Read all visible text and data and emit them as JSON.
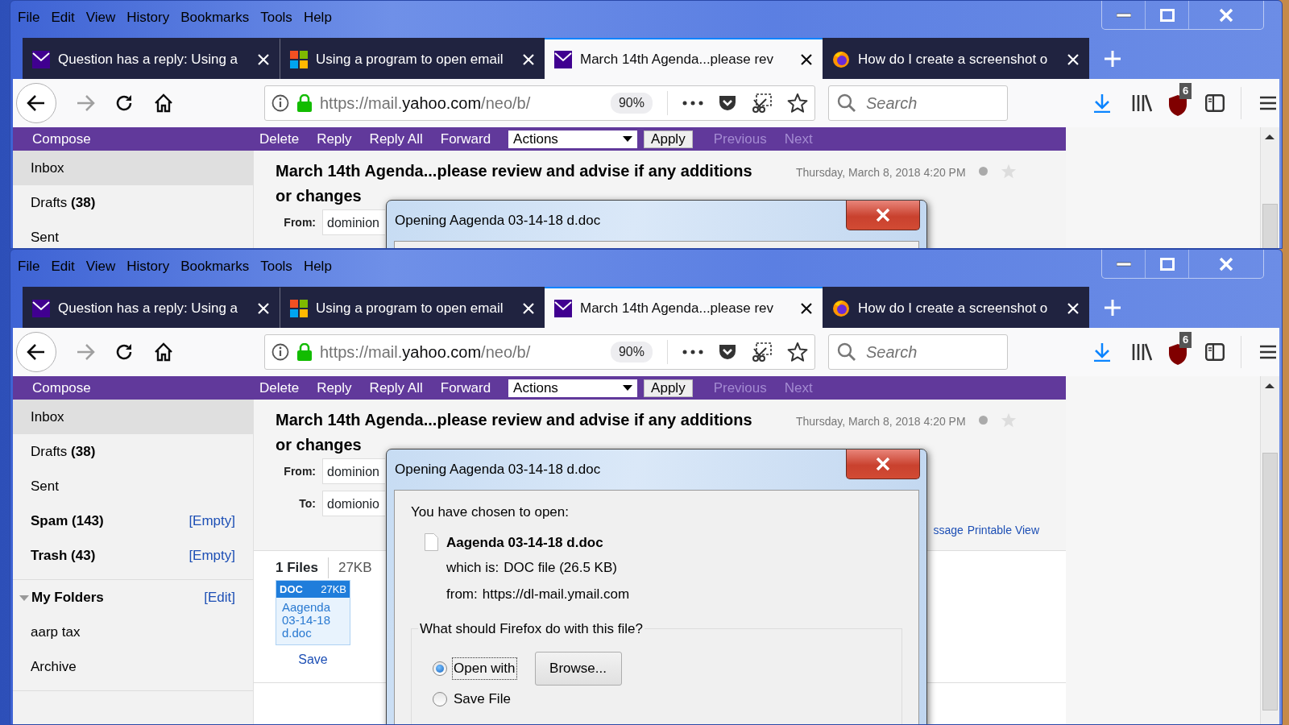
{
  "windows": [
    {
      "menu": [
        {
          "label": "File"
        },
        {
          "label": "Edit"
        },
        {
          "label": "View"
        },
        {
          "label": "History"
        },
        {
          "label": "Bookmarks"
        },
        {
          "label": "Tools"
        },
        {
          "label": "Help"
        }
      ],
      "tabs": [
        {
          "title": "Question has a reply: Using a",
          "kind": "envelope",
          "selected": false
        },
        {
          "title": "Using a program to open email",
          "kind": "squares",
          "selected": false
        },
        {
          "title": "March 14th Agenda...please rev",
          "kind": "envelope",
          "selected": true
        },
        {
          "title": "How do I create a screenshot o",
          "kind": "globe",
          "selected": false
        }
      ],
      "toolbar": {
        "url_scheme": "https://mail.",
        "url_domain": "yahoo.com",
        "url_path": "/neo/b/",
        "zoom": "90%",
        "search_placeholder": "Search",
        "addon_badge": "6"
      },
      "mail": {
        "toolbar": {
          "compose": "Compose",
          "actions": [
            {
              "label": "Delete",
              "disabled": false
            },
            {
              "label": "Reply",
              "disabled": false
            },
            {
              "label": "Reply All",
              "disabled": false
            },
            {
              "label": "Forward",
              "disabled": false
            }
          ],
          "select": "Actions",
          "apply": "Apply",
          "paging": [
            {
              "label": "Previous",
              "disabled": true
            },
            {
              "label": "Next",
              "disabled": true
            }
          ]
        },
        "folders": [
          {
            "label": "Inbox",
            "selected": true,
            "unread": false
          },
          {
            "label": "Drafts **(38)**",
            "selected": false,
            "unread": false
          },
          {
            "label": "Sent",
            "selected": false,
            "unread": false
          }
        ],
        "message": {
          "subject": "March 14th Agenda...please review and advise if any additions or changes",
          "date": "Thursday, March 8, 2018 4:20 PM",
          "fields": [
            {
              "label": "From:",
              "value": "dominion"
            }
          ]
        },
        "dialog": {
          "title": "Opening Aagenda 03-14-18 d.doc"
        }
      }
    },
    {
      "menu": [
        {
          "label": "File"
        },
        {
          "label": "Edit"
        },
        {
          "label": "View"
        },
        {
          "label": "History"
        },
        {
          "label": "Bookmarks"
        },
        {
          "label": "Tools"
        },
        {
          "label": "Help"
        }
      ],
      "tabs": [
        {
          "title": "Question has a reply: Using a",
          "kind": "envelope",
          "selected": false
        },
        {
          "title": "Using a program to open email",
          "kind": "squares",
          "selected": false
        },
        {
          "title": "March 14th Agenda...please rev",
          "kind": "envelope",
          "selected": true
        },
        {
          "title": "How do I create a screenshot o",
          "kind": "globe",
          "selected": false
        }
      ],
      "toolbar": {
        "url_scheme": "https://mail.",
        "url_domain": "yahoo.com",
        "url_path": "/neo/b/",
        "zoom": "90%",
        "search_placeholder": "Search",
        "addon_badge": "6"
      },
      "mail": {
        "toolbar": {
          "compose": "Compose",
          "actions": [
            {
              "label": "Delete",
              "disabled": false
            },
            {
              "label": "Reply",
              "disabled": false
            },
            {
              "label": "Reply All",
              "disabled": false
            },
            {
              "label": "Forward",
              "disabled": false
            }
          ],
          "select": "Actions",
          "apply": "Apply",
          "paging": [
            {
              "label": "Previous",
              "disabled": true
            },
            {
              "label": "Next",
              "disabled": true
            }
          ]
        },
        "folders": [
          {
            "label": "Inbox",
            "selected": true,
            "unread": false
          },
          {
            "label": "Drafts **(38)**",
            "selected": false,
            "unread": false
          },
          {
            "label": "Sent",
            "selected": false,
            "unread": false
          },
          {
            "label": "Spam (143)",
            "selected": false,
            "unread": true,
            "action": "[Empty]"
          },
          {
            "label": "Trash (43)",
            "selected": false,
            "unread": true,
            "action": "[Empty]"
          }
        ],
        "my_folders": {
          "title": "My Folders",
          "expanded": true,
          "action": "[Edit]",
          "items": [
            {
              "label": "aarp tax"
            },
            {
              "label": "Archive"
            }
          ]
        },
        "message": {
          "subject": "March 14th Agenda...please review and advise if any additions or changes",
          "date": "Thursday, March 8, 2018 4:20 PM",
          "fields": [
            {
              "label": "From:",
              "value": "dominion"
            },
            {
              "label": "To:",
              "value": "domionio"
            }
          ],
          "links": [
            "ssage",
            "Printable View"
          ],
          "attachments": {
            "count": "1 Files",
            "size": "27KB",
            "files": [
              {
                "type": "DOC",
                "size": "27KB",
                "name": "Aagenda 03-14-18 d.doc",
                "action": "Save"
              }
            ]
          }
        },
        "dialog": {
          "title": "Opening Aagenda 03-14-18 d.doc",
          "intro": "You have chosen to open:",
          "filename": "Aagenda 03-14-18 d.doc",
          "details": [
            {
              "label": "which is:",
              "value": "DOC file (26.5 KB)"
            },
            {
              "label": "from:",
              "value": "https://dl-mail.ymail.com"
            }
          ],
          "question": "What should Firefox do with this file?",
          "options": [
            {
              "label": "Open with",
              "selected": true
            },
            {
              "label": "Save File",
              "selected": false
            }
          ],
          "browse": "Browse..."
        }
      }
    }
  ]
}
